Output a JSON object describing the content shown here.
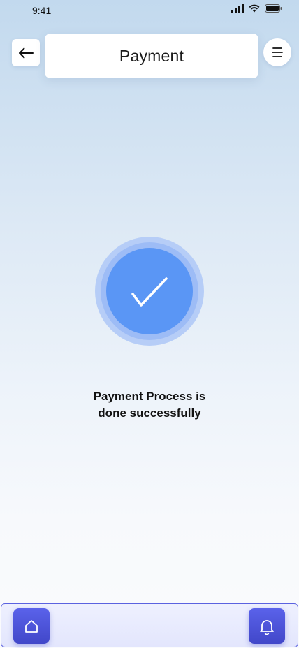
{
  "status_bar": {
    "time": "9:41",
    "icons": [
      "signal-icon",
      "wifi-icon",
      "battery-icon"
    ]
  },
  "header": {
    "title": "Payment",
    "back_icon": "arrow-left-icon",
    "menu_icon": "menu-icon"
  },
  "success": {
    "icon": "checkmark-icon",
    "message_line1": "Payment Process is",
    "message_line2": "done successfully"
  },
  "bottom_nav": {
    "items": [
      {
        "icon": "home-icon"
      },
      {
        "icon": "bell-icon"
      }
    ]
  },
  "colors": {
    "accent": "#5a96f5",
    "nav_button": "#4f56df",
    "nav_border": "#5b62e0"
  }
}
